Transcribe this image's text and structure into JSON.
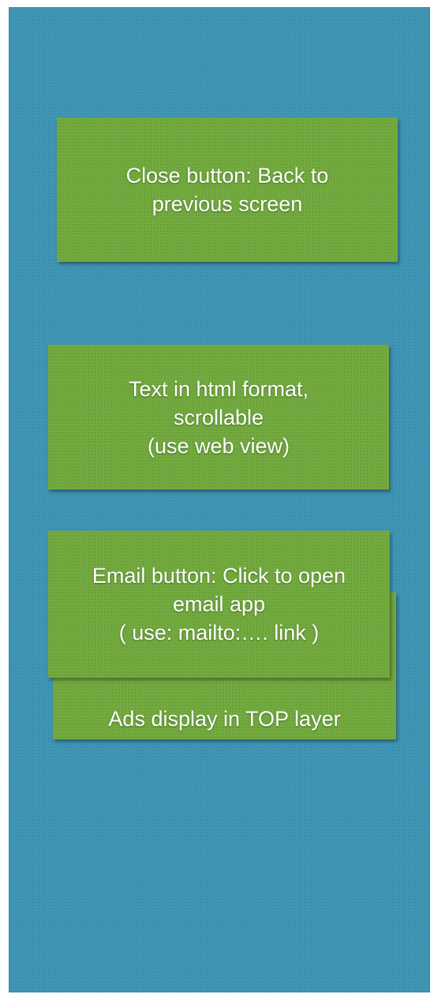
{
  "notes": {
    "close": {
      "lines": [
        "Close button: Back to",
        "previous screen"
      ]
    },
    "text": {
      "lines": [
        "Text in html format,",
        "scrollable",
        "(use web view)"
      ]
    },
    "email": {
      "lines": [
        "Email button: Click to open",
        "email app",
        "( use: mailto:…. link )"
      ]
    },
    "ads": {
      "lines": [
        "Ads display in TOP layer"
      ]
    }
  },
  "colors": {
    "background": "#3b93b3",
    "note": "#6fa83a",
    "text": "#ffffff"
  }
}
